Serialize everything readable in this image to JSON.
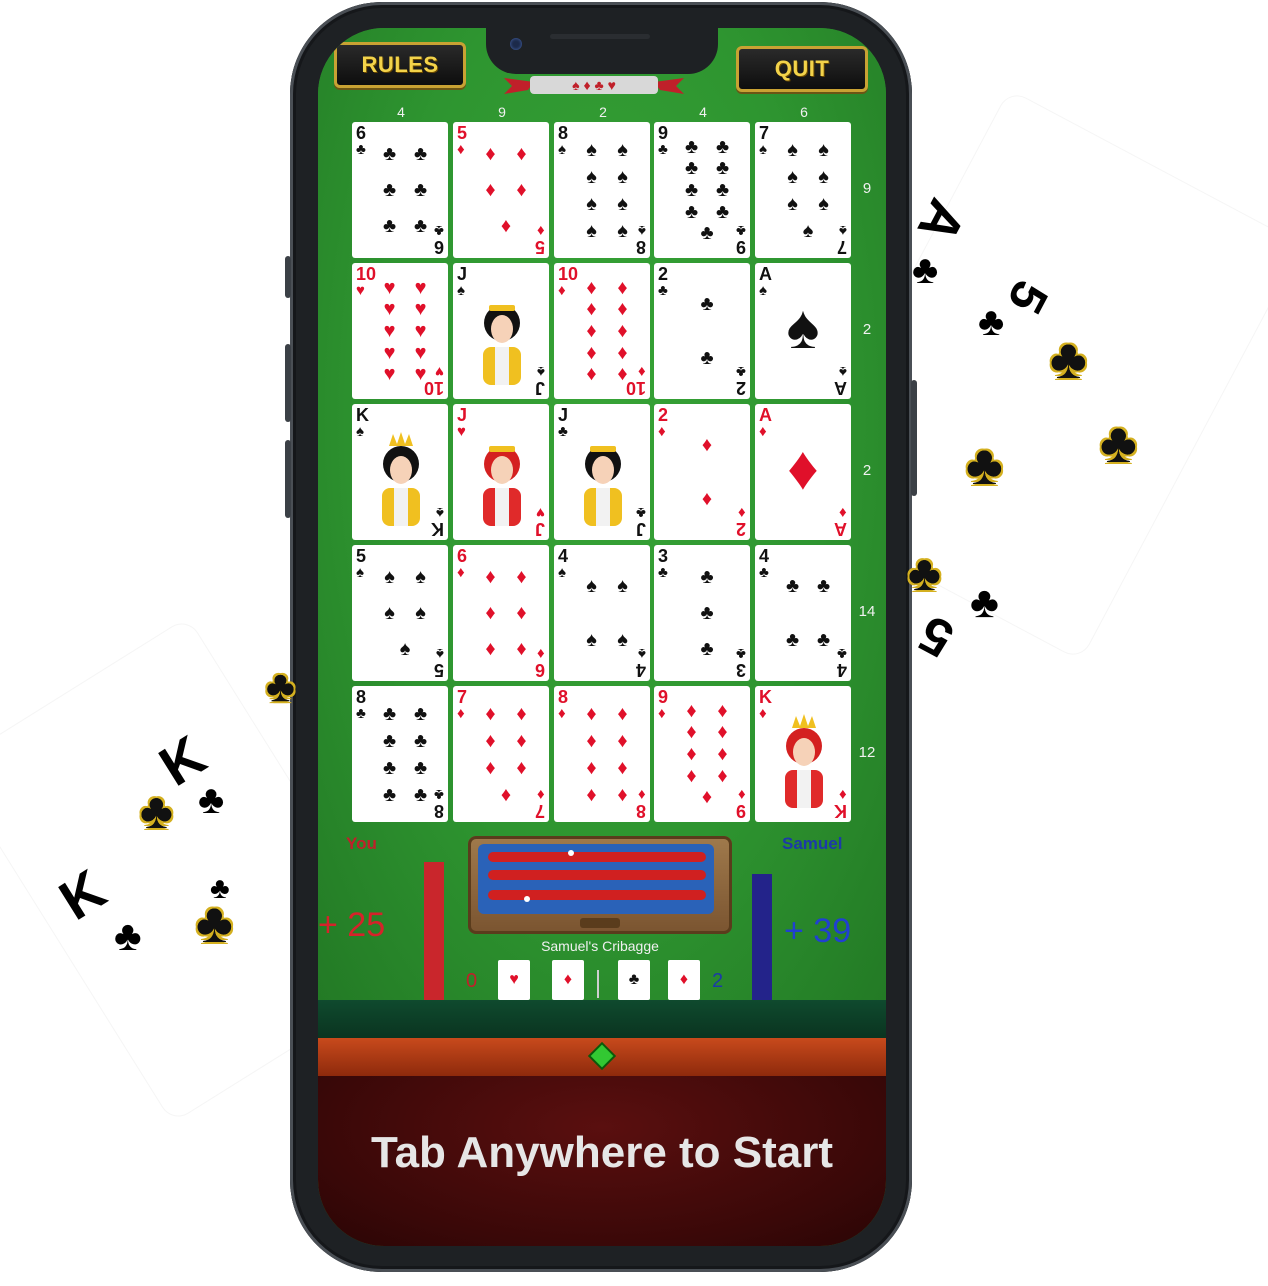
{
  "header": {
    "rules_label": "RULES",
    "quit_label": "QUIT"
  },
  "column_totals": [
    "4",
    "9",
    "2",
    "4",
    "6"
  ],
  "row_totals": [
    "9",
    "2",
    "2",
    "14",
    "12"
  ],
  "grid": [
    [
      {
        "rank": "6",
        "suit": "♣",
        "color": "black",
        "pips": 6
      },
      {
        "rank": "5",
        "suit": "♦",
        "color": "red",
        "pips": 5
      },
      {
        "rank": "8",
        "suit": "♠",
        "color": "black",
        "pips": 8
      },
      {
        "rank": "9",
        "suit": "♣",
        "color": "black",
        "pips": 9
      },
      {
        "rank": "7",
        "suit": "♠",
        "color": "black",
        "pips": 7
      }
    ],
    [
      {
        "rank": "10",
        "suit": "♥",
        "color": "red",
        "pips": 10
      },
      {
        "rank": "J",
        "suit": "♠",
        "color": "black",
        "face": "jack"
      },
      {
        "rank": "10",
        "suit": "♦",
        "color": "red",
        "pips": 10
      },
      {
        "rank": "2",
        "suit": "♣",
        "color": "black",
        "pips": 2
      },
      {
        "rank": "A",
        "suit": "♠",
        "color": "black",
        "ace": true
      }
    ],
    [
      {
        "rank": "K",
        "suit": "♠",
        "color": "black",
        "face": "king"
      },
      {
        "rank": "J",
        "suit": "♥",
        "color": "red",
        "face": "jack"
      },
      {
        "rank": "J",
        "suit": "♣",
        "color": "black",
        "face": "jack"
      },
      {
        "rank": "2",
        "suit": "♦",
        "color": "red",
        "pips": 2
      },
      {
        "rank": "A",
        "suit": "♦",
        "color": "red",
        "ace": true
      }
    ],
    [
      {
        "rank": "5",
        "suit": "♠",
        "color": "black",
        "pips": 5
      },
      {
        "rank": "6",
        "suit": "♦",
        "color": "red",
        "pips": 6
      },
      {
        "rank": "4",
        "suit": "♠",
        "color": "black",
        "pips": 4
      },
      {
        "rank": "3",
        "suit": "♣",
        "color": "black",
        "pips": 3
      },
      {
        "rank": "4",
        "suit": "♣",
        "color": "black",
        "pips": 4
      }
    ],
    [
      {
        "rank": "8",
        "suit": "♣",
        "color": "black",
        "pips": 8
      },
      {
        "rank": "7",
        "suit": "♦",
        "color": "red",
        "pips": 7
      },
      {
        "rank": "8",
        "suit": "♦",
        "color": "red",
        "pips": 8
      },
      {
        "rank": "9",
        "suit": "♦",
        "color": "red",
        "pips": 9
      },
      {
        "rank": "K",
        "suit": "♦",
        "color": "red",
        "face": "king"
      }
    ]
  ],
  "players": {
    "you": {
      "name": "You",
      "score": "+ 25",
      "crib_count": "0"
    },
    "samuel": {
      "name": "Samuel",
      "score": "+ 39",
      "crib_count": "2"
    }
  },
  "board_label": "Samuel's Cribagge",
  "crib_cards": [
    {
      "suit": "♥",
      "color": "red"
    },
    {
      "suit": "♦",
      "color": "red"
    },
    {
      "suit": "♣",
      "color": "black"
    },
    {
      "suit": "♦",
      "color": "red"
    }
  ],
  "start_prompt": "Tab Anywhere to Start",
  "decor": {
    "right_card_top_rank": "A",
    "right_card_mid_rank": "5",
    "right_card_bottom_rank": "5",
    "left_card_rank_1": "K",
    "left_card_rank_2": "K"
  },
  "colors": {
    "felt": "#2e9530",
    "red_player": "#c9262c",
    "blue_player": "#23238a",
    "gold": "#c9a233"
  }
}
